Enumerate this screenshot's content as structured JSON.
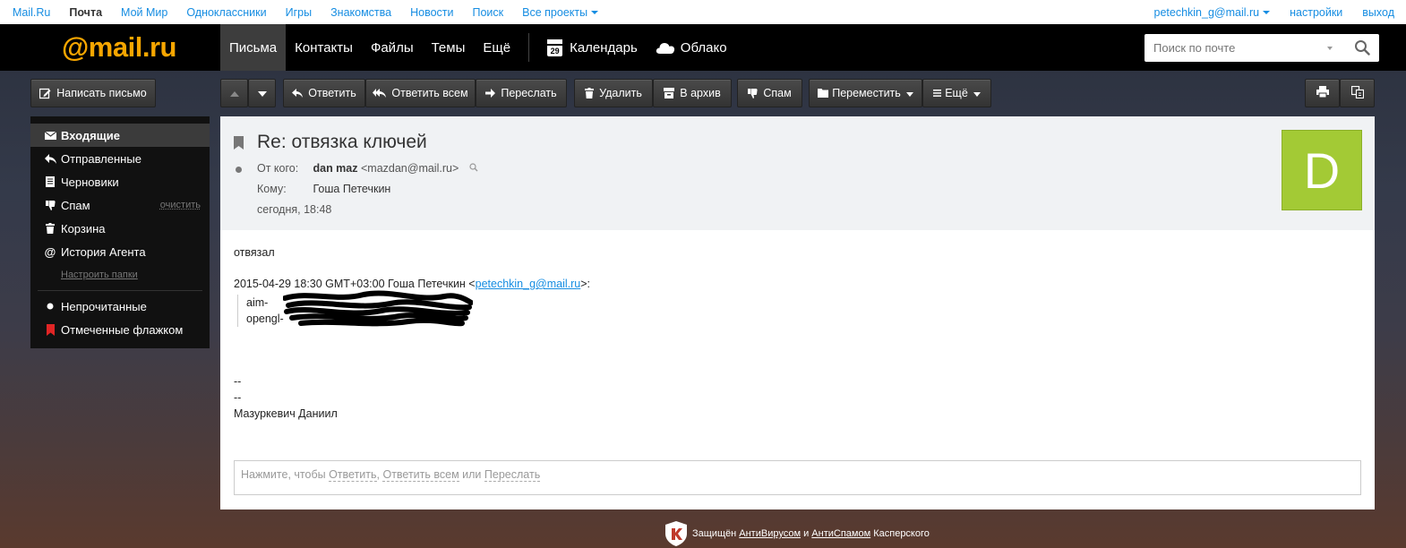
{
  "portal": {
    "links": [
      "Mail.Ru",
      "Почта",
      "Мой Мир",
      "Одноклассники",
      "Игры",
      "Знакомства",
      "Новости",
      "Поиск",
      "Все проекты"
    ],
    "user_email": "petechkin_g@mail.ru",
    "settings": "настройки",
    "logout": "выход"
  },
  "header": {
    "logo": {
      "at": "@",
      "mail": "mail",
      "dot": ".",
      "ru": "ru"
    },
    "nav": [
      "Письма",
      "Контакты",
      "Файлы",
      "Темы",
      "Ещё"
    ],
    "calendar_label": "Календарь",
    "calendar_day": "29",
    "cloud_label": "Облако",
    "search_placeholder": "Поиск по почте"
  },
  "toolbar": {
    "compose": "Написать письмо",
    "reply": "Ответить",
    "reply_all": "Ответить всем",
    "forward": "Переслать",
    "delete": "Удалить",
    "archive": "В архив",
    "spam": "Спам",
    "move": "Переместить",
    "more": "Ещё"
  },
  "sidebar": {
    "folders": [
      {
        "label": "Входящие",
        "icon": "envelope-icon"
      },
      {
        "label": "Отправленные",
        "icon": "reply-icon"
      },
      {
        "label": "Черновики",
        "icon": "document-icon"
      },
      {
        "label": "Спам",
        "icon": "thumbs-down-icon"
      },
      {
        "label": "Корзина",
        "icon": "trash-icon"
      },
      {
        "label": "История Агента",
        "icon": "at-icon"
      }
    ],
    "clean_label": "очистить",
    "setup_folders": "Настроить папки",
    "filters": [
      {
        "label": "Непрочитанные",
        "icon": "dot-icon"
      },
      {
        "label": "Отмеченные флажком",
        "icon": "flag-icon"
      }
    ]
  },
  "letter": {
    "subject": "Re: отвязка ключей",
    "from_label": "От кого:",
    "from_name": "dan maz",
    "from_email": "<mazdan@mail.ru>",
    "to_label": "Кому:",
    "to_name": "Гоша Петечкин",
    "date": "сегодня, 18:48",
    "avatar_letter": "D",
    "body_first": "отвязал",
    "quote_header_pre": "2015-04-29 18:30 GMT+03:00 Гоша Петечкин <",
    "quote_header_email": "petechkin_g@mail.ru",
    "quote_header_post": ">:",
    "quote_lines": [
      "aim-",
      "opengl-"
    ],
    "signature_lines": [
      "--",
      "--",
      "Мазуркевич Даниил"
    ],
    "reply_prompt": "Нажмите, чтобы",
    "reply_link": "Ответить",
    "reply_all_link": "Ответить всем",
    "or": "или",
    "forward_link": "Переслать"
  },
  "footer": {
    "protected": "Защищён",
    "antivirus": "АнтиВирусом",
    "and": "и",
    "antispam": "АнтиСпамом",
    "kaspersky": "Касперского"
  }
}
